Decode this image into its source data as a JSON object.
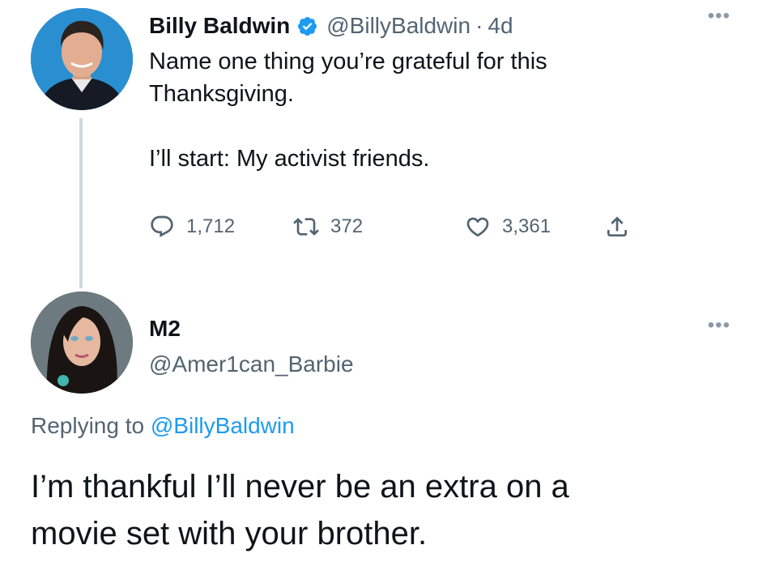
{
  "colors": {
    "text": "#0f1419",
    "secondary": "#536471",
    "link": "#1d9bf0",
    "verified": "#1d9bf0",
    "thread_line": "#cfd9de"
  },
  "parent_tweet": {
    "author_name": "Billy Baldwin",
    "verified_icon": "verified-badge-icon",
    "handle": "@BillyBaldwin",
    "separator": "·",
    "time": "4d",
    "more_icon": "more-icon",
    "text": "Name one thing you’re grateful for this\nThanksgiving.\n\nI’ll start: My activist friends.",
    "actions": {
      "reply": {
        "icon": "reply-icon",
        "count": "1,712"
      },
      "retweet": {
        "icon": "retweet-icon",
        "count": "372"
      },
      "like": {
        "icon": "heart-icon",
        "count": "3,361"
      },
      "share": {
        "icon": "share-icon"
      }
    }
  },
  "reply_tweet": {
    "author_name": "M2",
    "handle": "@Amer1can_Barbie",
    "more_icon": "more-icon",
    "replying_prefix": "Replying to",
    "replying_mention": "@BillyBaldwin",
    "text": "I’m thankful I’ll never be an extra on a\nmovie set with your brother."
  }
}
